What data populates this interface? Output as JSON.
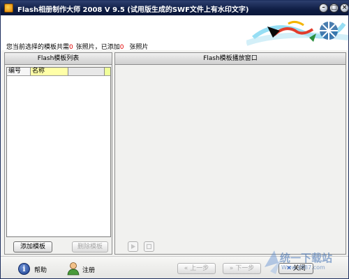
{
  "window": {
    "title": "Flash相册制作大师 2008 V 9.5 (试用版生成的SWF文件上有水印文字)",
    "controls": {
      "minimize": "–",
      "maximize": "□",
      "close": "×"
    }
  },
  "header": {
    "prefix": "您当前选择的模板共需",
    "required_count": "0",
    "mid": "张照片，已添加",
    "added_count": "0",
    "suffix": "张照片"
  },
  "template_list": {
    "title": "Flash模板列表",
    "columns": [
      "编号",
      "名称"
    ],
    "rows": [],
    "add_button": "添加模板",
    "delete_button": "删除模板"
  },
  "player": {
    "title": "Flash模板播放窗口",
    "play_icon": "play-icon",
    "stop_icon": "stop-icon"
  },
  "footer": {
    "help_label": "帮助",
    "register_label": "注册",
    "prev_button": "上一步",
    "next_button": "下一步",
    "close_button": "关闭"
  },
  "watermark": {
    "text": "统一下载站",
    "url": "Www.3987.com"
  },
  "colors": {
    "title_bar": "#0f1d44",
    "count_red": "#e00000",
    "name_column_highlight": "#ffffa8"
  }
}
